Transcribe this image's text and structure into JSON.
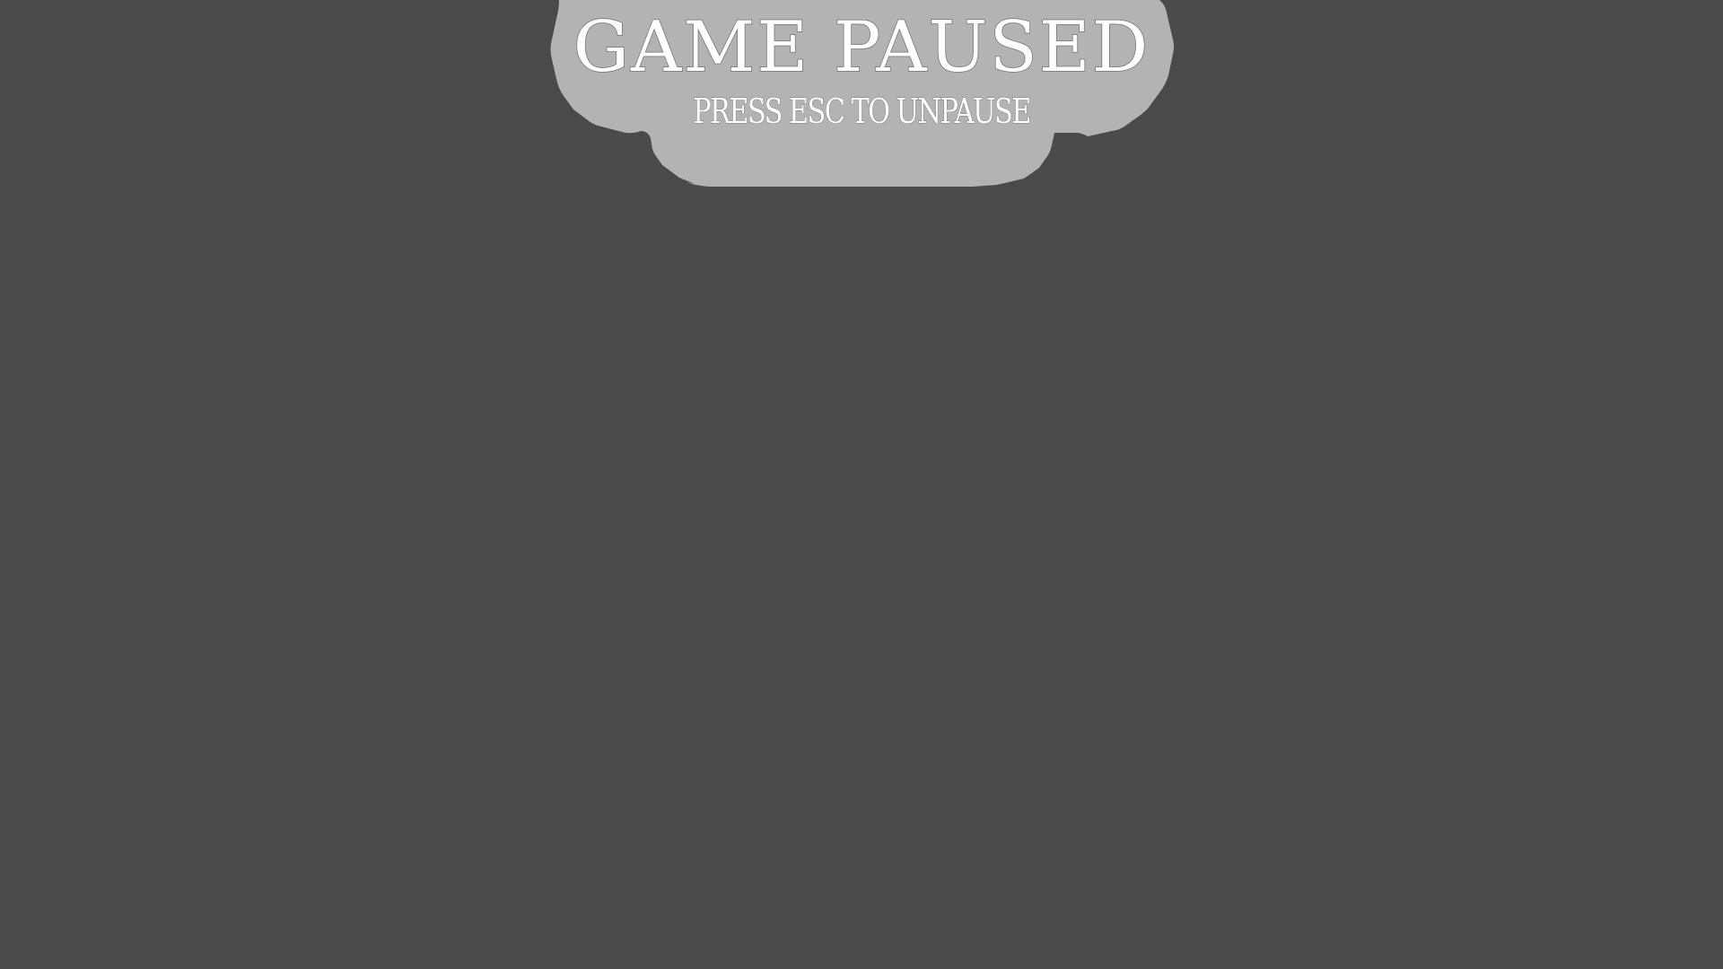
{
  "pause_menu": {
    "title": "Game Paused",
    "subtitle": "Press ESC to unpause"
  },
  "colors": {
    "background": "#4a4a4a",
    "panel": "#b3b3b3",
    "text": "#ffffff"
  }
}
